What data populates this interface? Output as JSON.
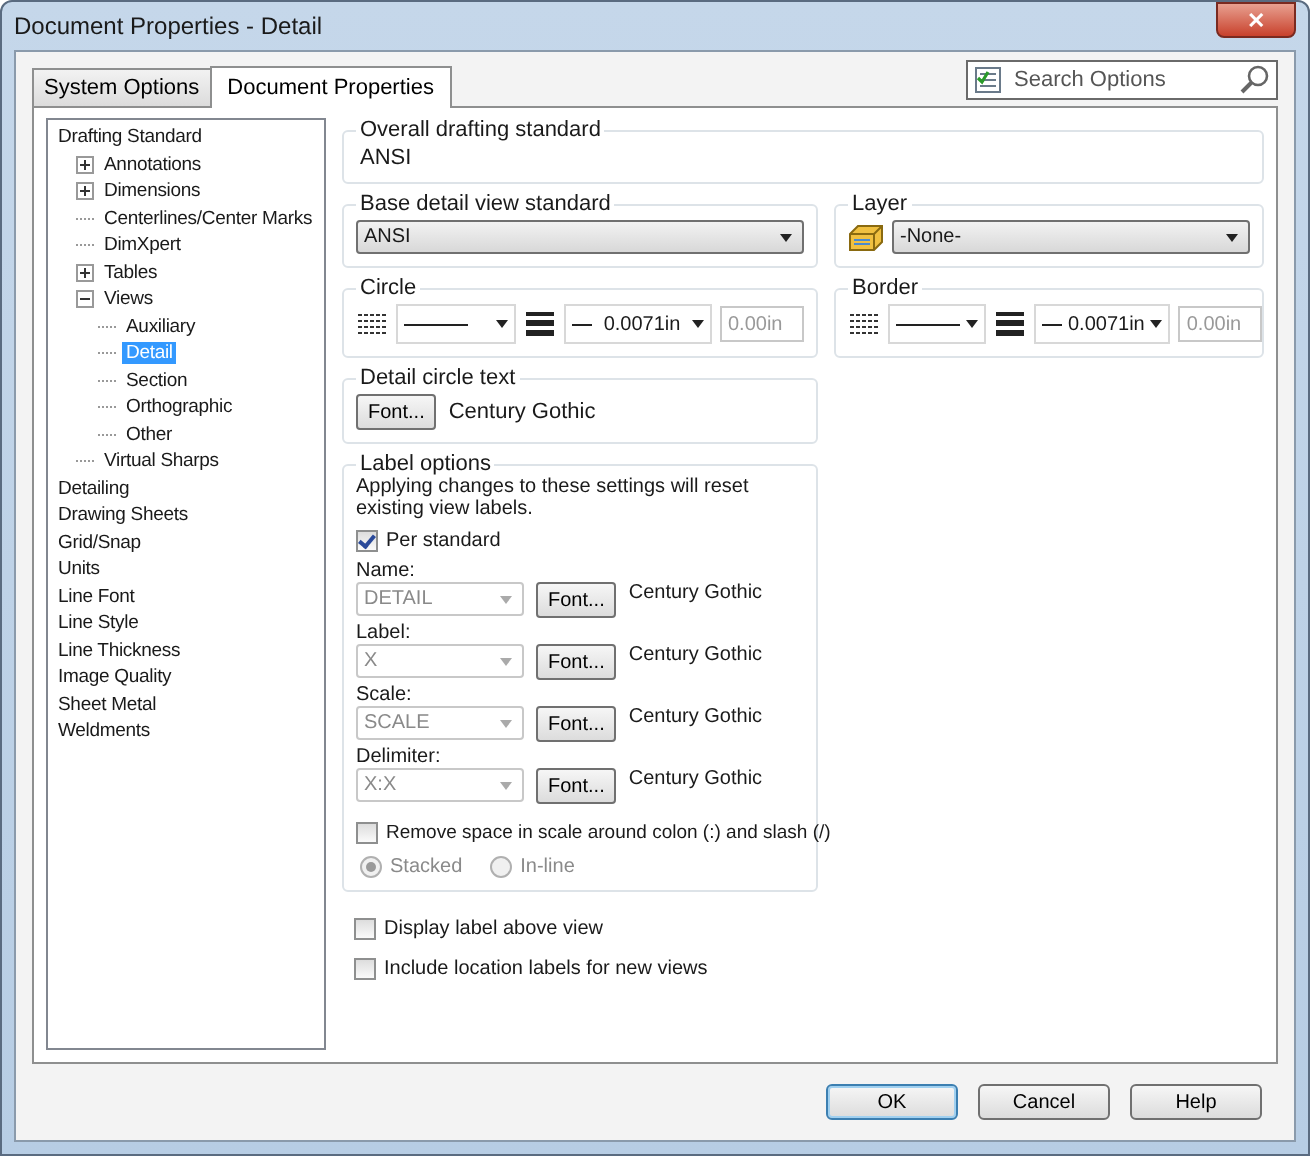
{
  "window": {
    "title": "Document Properties - Detail",
    "close": "✕"
  },
  "tabs": [
    {
      "label": "System Options",
      "selected": false
    },
    {
      "label": "Document Properties",
      "selected": true
    }
  ],
  "search": {
    "placeholder": "Search Options"
  },
  "tree": [
    {
      "label": "Drafting Standard",
      "selected": false,
      "children": [
        {
          "label": "Annotations",
          "selected": false,
          "expanded": false
        },
        {
          "label": "Dimensions",
          "selected": false,
          "expanded": false
        },
        {
          "label": "Centerlines/Center Marks",
          "selected": false
        },
        {
          "label": "DimXpert",
          "selected": false
        },
        {
          "label": "Tables",
          "selected": false,
          "expanded": false
        },
        {
          "label": "Views",
          "selected": false,
          "expanded": true,
          "children": [
            {
              "label": "Auxiliary",
              "selected": false
            },
            {
              "label": "Detail",
              "selected": true
            },
            {
              "label": "Section",
              "selected": false
            },
            {
              "label": "Orthographic",
              "selected": false
            },
            {
              "label": "Other",
              "selected": false
            }
          ]
        },
        {
          "label": "Virtual Sharps",
          "selected": false
        }
      ]
    },
    {
      "label": "Detailing",
      "selected": false
    },
    {
      "label": "Drawing Sheets",
      "selected": false
    },
    {
      "label": "Grid/Snap",
      "selected": false
    },
    {
      "label": "Units",
      "selected": false
    },
    {
      "label": "Line Font",
      "selected": false
    },
    {
      "label": "Line Style",
      "selected": false
    },
    {
      "label": "Line Thickness",
      "selected": false
    },
    {
      "label": "Image Quality",
      "selected": false
    },
    {
      "label": "Sheet Metal",
      "selected": false
    },
    {
      "label": "Weldments",
      "selected": false
    }
  ],
  "overall": {
    "title": "Overall drafting standard",
    "value": "ANSI"
  },
  "base_standard": {
    "title": "Base detail view standard",
    "value": "ANSI"
  },
  "layer": {
    "title": "Layer",
    "value": "-None-"
  },
  "circle": {
    "title": "Circle",
    "thickness": "0.0071in",
    "custom": "0.00in"
  },
  "border": {
    "title": "Border",
    "thickness": "0.0071in",
    "custom": "0.00in"
  },
  "circle_text": {
    "title": "Detail circle text",
    "button": "Font...",
    "font": "Century Gothic"
  },
  "label_options": {
    "title": "Label options",
    "note": "Applying changes to these settings will reset existing view labels.",
    "per_standard": {
      "label": "Per standard",
      "checked": true
    },
    "rows": [
      {
        "label": "Name:",
        "value": "DETAIL",
        "disabled": true,
        "button": "Font...",
        "font": "Century Gothic"
      },
      {
        "label": "Label:",
        "value": "X",
        "disabled": true,
        "button": "Font...",
        "font": "Century Gothic"
      },
      {
        "label": "Scale:",
        "value": "SCALE",
        "disabled": true,
        "button": "Font...",
        "font": "Century Gothic"
      },
      {
        "label": "Delimiter:",
        "value": "X:X",
        "disabled": true,
        "button": "Font...",
        "font": "Century Gothic"
      }
    ],
    "remove_space": {
      "label": "Remove space in scale around colon (:) and slash (/)",
      "checked": false
    },
    "radios": [
      {
        "label": "Stacked",
        "selected": true,
        "disabled": true
      },
      {
        "label": "In-line",
        "selected": false,
        "disabled": true
      }
    ]
  },
  "checkboxes": [
    {
      "label": "Display label above view",
      "checked": false
    },
    {
      "label": "Include location labels for new views",
      "checked": false
    }
  ],
  "buttons": [
    {
      "label": "OK",
      "default": true
    },
    {
      "label": "Cancel",
      "default": false
    },
    {
      "label": "Help",
      "default": false
    }
  ]
}
